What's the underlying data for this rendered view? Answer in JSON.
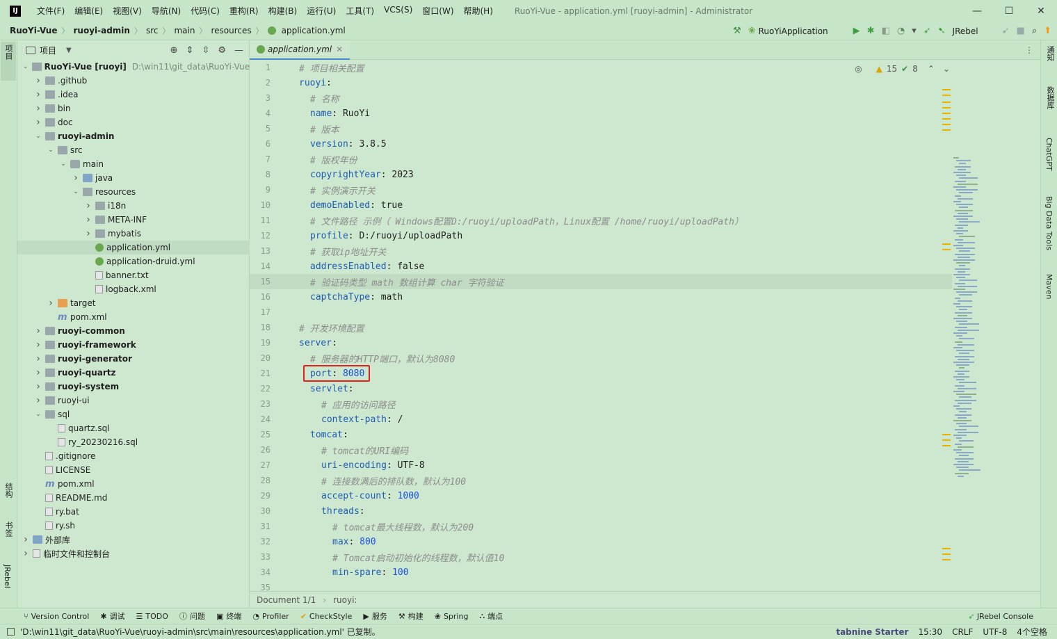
{
  "window": {
    "app_logo": "IJ",
    "menu": [
      "文件(F)",
      "编辑(E)",
      "视图(V)",
      "导航(N)",
      "代码(C)",
      "重构(R)",
      "构建(B)",
      "运行(U)",
      "工具(T)",
      "VCS(S)",
      "窗口(W)",
      "帮助(H)"
    ],
    "title": "RuoYi-Vue - application.yml [ruoyi-admin] - Administrator"
  },
  "breadcrumbs": [
    "RuoYi-Vue",
    "ruoyi-admin",
    "src",
    "main",
    "resources",
    "application.yml"
  ],
  "run_config": "RuoYiApplication",
  "jrebel_label": "JRebel",
  "left_strip": {
    "project": "项目",
    "structure": "结构",
    "bookmarks": "书签",
    "jrebel": "JRebel"
  },
  "right_strip": {
    "notifications": "通知",
    "database": "数据库",
    "chatgpt": "ChatGPT",
    "bigdata": "Big Data Tools",
    "maven": "Maven"
  },
  "project_panel": {
    "title": "项目",
    "tree": [
      {
        "name": "RuoYi-Vue [ruoyi]",
        "path": "D:\\win11\\git_data\\RuoYi-Vue",
        "depth": 0,
        "arrow": "open",
        "icon": "folder",
        "bold": true
      },
      {
        "name": ".github",
        "depth": 1,
        "arrow": "closed",
        "icon": "folder"
      },
      {
        "name": ".idea",
        "depth": 1,
        "arrow": "closed",
        "icon": "folder"
      },
      {
        "name": "bin",
        "depth": 1,
        "arrow": "closed",
        "icon": "folder"
      },
      {
        "name": "doc",
        "depth": 1,
        "arrow": "closed",
        "icon": "folder"
      },
      {
        "name": "ruoyi-admin",
        "depth": 1,
        "arrow": "open",
        "icon": "folder",
        "bold": true
      },
      {
        "name": "src",
        "depth": 2,
        "arrow": "open",
        "icon": "folder"
      },
      {
        "name": "main",
        "depth": 3,
        "arrow": "open",
        "icon": "folder"
      },
      {
        "name": "java",
        "depth": 4,
        "arrow": "closed",
        "icon": "folder-blue"
      },
      {
        "name": "resources",
        "depth": 4,
        "arrow": "open",
        "icon": "folder"
      },
      {
        "name": "i18n",
        "depth": 5,
        "arrow": "closed",
        "icon": "folder"
      },
      {
        "name": "META-INF",
        "depth": 5,
        "arrow": "closed",
        "icon": "folder"
      },
      {
        "name": "mybatis",
        "depth": 5,
        "arrow": "closed",
        "icon": "folder"
      },
      {
        "name": "application.yml",
        "depth": 5,
        "arrow": "none",
        "icon": "yml",
        "selected": true
      },
      {
        "name": "application-druid.yml",
        "depth": 5,
        "arrow": "none",
        "icon": "yml"
      },
      {
        "name": "banner.txt",
        "depth": 5,
        "arrow": "none",
        "icon": "file"
      },
      {
        "name": "logback.xml",
        "depth": 5,
        "arrow": "none",
        "icon": "file"
      },
      {
        "name": "target",
        "depth": 2,
        "arrow": "closed",
        "icon": "folder-orange"
      },
      {
        "name": "pom.xml",
        "depth": 2,
        "arrow": "none",
        "icon": "maven"
      },
      {
        "name": "ruoyi-common",
        "depth": 1,
        "arrow": "closed",
        "icon": "folder",
        "bold": true
      },
      {
        "name": "ruoyi-framework",
        "depth": 1,
        "arrow": "closed",
        "icon": "folder",
        "bold": true
      },
      {
        "name": "ruoyi-generator",
        "depth": 1,
        "arrow": "closed",
        "icon": "folder",
        "bold": true
      },
      {
        "name": "ruoyi-quartz",
        "depth": 1,
        "arrow": "closed",
        "icon": "folder",
        "bold": true
      },
      {
        "name": "ruoyi-system",
        "depth": 1,
        "arrow": "closed",
        "icon": "folder",
        "bold": true
      },
      {
        "name": "ruoyi-ui",
        "depth": 1,
        "arrow": "closed",
        "icon": "folder"
      },
      {
        "name": "sql",
        "depth": 1,
        "arrow": "open",
        "icon": "folder"
      },
      {
        "name": "quartz.sql",
        "depth": 2,
        "arrow": "none",
        "icon": "file"
      },
      {
        "name": "ry_20230216.sql",
        "depth": 2,
        "arrow": "none",
        "icon": "file"
      },
      {
        "name": ".gitignore",
        "depth": 1,
        "arrow": "none",
        "icon": "file"
      },
      {
        "name": "LICENSE",
        "depth": 1,
        "arrow": "none",
        "icon": "file"
      },
      {
        "name": "pom.xml",
        "depth": 1,
        "arrow": "none",
        "icon": "maven"
      },
      {
        "name": "README.md",
        "depth": 1,
        "arrow": "none",
        "icon": "file"
      },
      {
        "name": "ry.bat",
        "depth": 1,
        "arrow": "none",
        "icon": "file"
      },
      {
        "name": "ry.sh",
        "depth": 1,
        "arrow": "none",
        "icon": "file"
      },
      {
        "name": "外部库",
        "depth": 0,
        "arrow": "closed",
        "icon": "lib"
      },
      {
        "name": "临时文件和控制台",
        "depth": 0,
        "arrow": "closed",
        "icon": "scratch"
      }
    ]
  },
  "editor": {
    "tab": "application.yml",
    "warnings": "15",
    "checks": "8",
    "current_line": 15,
    "boxed_line": 21,
    "lines": [
      {
        "n": "1",
        "indent": 0,
        "comment": "# 项目相关配置"
      },
      {
        "n": "2",
        "indent": 0,
        "key": "ruoyi",
        "value": ""
      },
      {
        "n": "3",
        "indent": 1,
        "comment": "# 名称"
      },
      {
        "n": "4",
        "indent": 1,
        "key": "name",
        "value": "RuoYi"
      },
      {
        "n": "5",
        "indent": 1,
        "comment": "# 版本"
      },
      {
        "n": "6",
        "indent": 1,
        "key": "version",
        "value": "3.8.5"
      },
      {
        "n": "7",
        "indent": 1,
        "comment": "# 版权年份"
      },
      {
        "n": "8",
        "indent": 1,
        "key": "copyrightYear",
        "value": "2023"
      },
      {
        "n": "9",
        "indent": 1,
        "comment": "# 实例演示开关"
      },
      {
        "n": "10",
        "indent": 1,
        "key": "demoEnabled",
        "value": "true"
      },
      {
        "n": "11",
        "indent": 1,
        "comment": "# 文件路径 示例（ Windows配置D:/ruoyi/uploadPath，Linux配置 /home/ruoyi/uploadPath）"
      },
      {
        "n": "12",
        "indent": 1,
        "key": "profile",
        "value": "D:/ruoyi/uploadPath"
      },
      {
        "n": "13",
        "indent": 1,
        "comment": "# 获取ip地址开关"
      },
      {
        "n": "14",
        "indent": 1,
        "key": "addressEnabled",
        "value": "false"
      },
      {
        "n": "15",
        "indent": 1,
        "comment": "# 验证码类型 math 数组计算 char 字符验证"
      },
      {
        "n": "16",
        "indent": 1,
        "key": "captchaType",
        "value": "math"
      },
      {
        "n": "17",
        "indent": 0,
        "blank": true
      },
      {
        "n": "18",
        "indent": 0,
        "comment": "# 开发环境配置"
      },
      {
        "n": "19",
        "indent": 0,
        "key": "server",
        "value": ""
      },
      {
        "n": "20",
        "indent": 1,
        "comment": "# 服务器的HTTP端口，默认为8080"
      },
      {
        "n": "21",
        "indent": 1,
        "key": "port",
        "value": "8080",
        "numeric": true
      },
      {
        "n": "22",
        "indent": 1,
        "key": "servlet",
        "value": ""
      },
      {
        "n": "23",
        "indent": 2,
        "comment": "# 应用的访问路径"
      },
      {
        "n": "24",
        "indent": 2,
        "key": "context-path",
        "value": "/"
      },
      {
        "n": "25",
        "indent": 1,
        "key": "tomcat",
        "value": ""
      },
      {
        "n": "26",
        "indent": 2,
        "comment": "# tomcat的URI编码"
      },
      {
        "n": "27",
        "indent": 2,
        "key": "uri-encoding",
        "value": "UTF-8"
      },
      {
        "n": "28",
        "indent": 2,
        "comment": "# 连接数满后的排队数，默认为100"
      },
      {
        "n": "29",
        "indent": 2,
        "key": "accept-count",
        "value": "1000",
        "numeric": true
      },
      {
        "n": "30",
        "indent": 2,
        "key": "threads",
        "value": ""
      },
      {
        "n": "31",
        "indent": 3,
        "comment": "# tomcat最大线程数，默认为200"
      },
      {
        "n": "32",
        "indent": 3,
        "key": "max",
        "value": "800",
        "numeric": true
      },
      {
        "n": "33",
        "indent": 3,
        "comment": "# Tomcat启动初始化的线程数，默认值10"
      },
      {
        "n": "34",
        "indent": 3,
        "key": "min-spare",
        "value": "100",
        "numeric": true
      },
      {
        "n": "35",
        "indent": 0,
        "blank": true
      }
    ],
    "doc_status": "Document 1/1",
    "doc_path": "ruoyi:"
  },
  "tool_windows": [
    {
      "icon": "branch-icon",
      "label": "Version Control"
    },
    {
      "icon": "bug-icon",
      "label": "调试"
    },
    {
      "icon": "list-icon",
      "label": "TODO"
    },
    {
      "icon": "info-icon",
      "label": "问题"
    },
    {
      "icon": "terminal-icon",
      "label": "终端"
    },
    {
      "icon": "profiler-icon",
      "label": "Profiler"
    },
    {
      "icon": "check-icon",
      "label": "CheckStyle"
    },
    {
      "icon": "play-icon",
      "label": "服务"
    },
    {
      "icon": "hammer-icon",
      "label": "构建"
    },
    {
      "icon": "spring-icon",
      "label": "Spring"
    },
    {
      "icon": "endpoint-icon",
      "label": "端点"
    }
  ],
  "jrebel_console": "JRebel Console",
  "status": {
    "message": "'D:\\win11\\git_data\\RuoYi-Vue\\ruoyi-admin\\src\\main\\resources\\application.yml' 已复制。",
    "tabnine": "tabnine Starter",
    "position": "15:30",
    "line_sep": "CRLF",
    "encoding": "UTF-8",
    "indent": "4个空格"
  },
  "colors": {
    "background": "#cde8cf",
    "highlight_box": "#e0201b",
    "key": "#1f5bb5",
    "comment": "#8c8c8c",
    "number": "#1750eb"
  }
}
